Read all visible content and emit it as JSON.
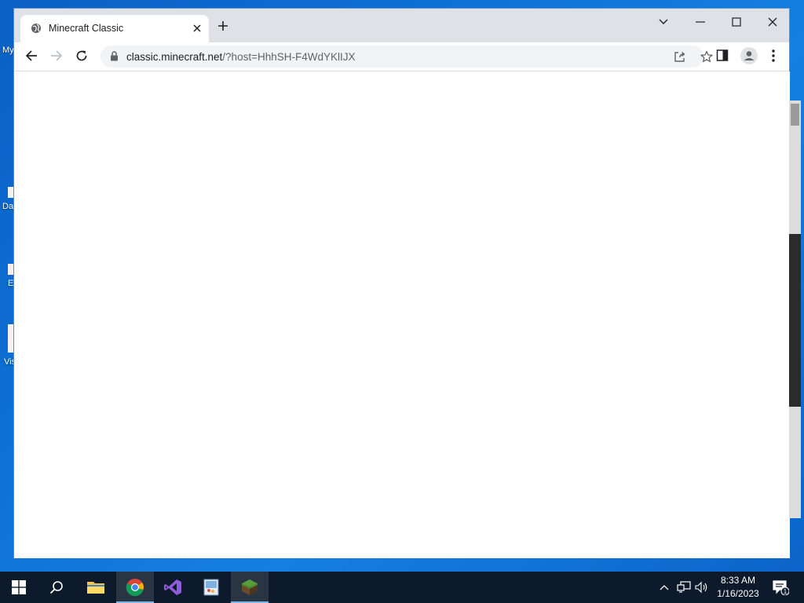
{
  "desktop": {
    "icons": [
      {
        "label": "My"
      },
      {
        "label": "Da"
      },
      {
        "label": "E"
      },
      {
        "label": "Vis"
      }
    ]
  },
  "browser": {
    "tab": {
      "title": "Minecraft Classic"
    },
    "address": {
      "host": "classic.minecraft.net",
      "path": "/?host=HhhSH-F4WdYKlIJX"
    }
  },
  "taskbar": {
    "clock": {
      "time": "8:33 AM",
      "date": "1/16/2023"
    },
    "notification_count": "1"
  },
  "colors": {
    "desktop": "#0f72d6",
    "taskbar": "#0d1a2b",
    "tabstrip": "#dee1e6",
    "omnibox": "#f1f3f4"
  }
}
